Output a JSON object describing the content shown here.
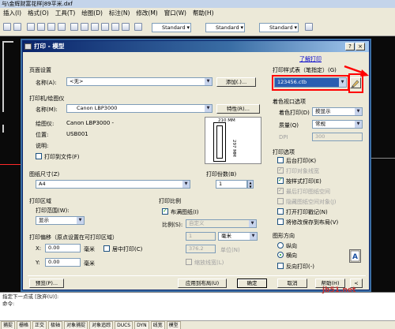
{
  "app": {
    "title": "与\\金辉财富花样|89平米.dxf"
  },
  "menu": [
    "插入(I)",
    "格式(O)",
    "工具(T)",
    "绘图(D)",
    "标注(N)",
    "修改(M)",
    "窗口(W)",
    "帮助(H)"
  ],
  "toolbar": {
    "style1": "Standard",
    "style2": "Standard",
    "style3": "Standard"
  },
  "command_line": [
    "指定下一点或 [放弃(U)]:",
    "命令:"
  ],
  "statusbar": [
    "捕捉",
    "栅格",
    "正交",
    "极轴",
    "对象捕捉",
    "对象追踪",
    "DUCS",
    "DYN",
    "线宽",
    "模型"
  ],
  "dialog": {
    "title": "打印 - 模型",
    "help_icon": "?",
    "close_icon": "×",
    "learn_link": "了解打印",
    "page_setup": {
      "group": "页面设置",
      "name_label": "名称(A):",
      "name_value": "<无>",
      "add_button": "添加(.)..."
    },
    "printer": {
      "group": "打印机/绘图仪",
      "name_label": "名称(M):",
      "name_value": "Canon LBP3000",
      "properties_button": "特性(R)...",
      "plotter_label": "绘图仪:",
      "plotter_value": "Canon LBP3000 -",
      "where_label": "位置:",
      "where_value": "USB001",
      "desc_label": "说明:",
      "print_to_file": "打印到文件(F)"
    },
    "preview": {
      "width_dim": "210 MM",
      "height_dim": "297 MM"
    },
    "paper_size": {
      "group": "图纸尺寸(Z)",
      "value": "A4"
    },
    "copies": {
      "label": "打印份数(B)",
      "value": "1"
    },
    "plot_area": {
      "group": "打印区域",
      "range_label": "打印范围(W):",
      "range_value": "显示"
    },
    "plot_scale": {
      "group": "打印比例",
      "fit_paper": "布满图纸(I)",
      "scale_label": "比例(S):",
      "scale_value": "自定义",
      "value1": "1",
      "unit1": "毫米",
      "value2": "376.2",
      "unit2": "单位(N)",
      "scale_lineweights": "缩放线宽(L)"
    },
    "plot_offset": {
      "group": "打印偏移（原点设置在可打印区域）",
      "x_label": "X:",
      "x_value": "0.00",
      "x_unit": "毫米",
      "center_plot": "居中打印(C)",
      "y_label": "Y:",
      "y_value": "0.00",
      "y_unit": "毫米"
    },
    "plot_style": {
      "group": "打印样式表（笔指定）(G)",
      "value": "123456.ctb"
    },
    "shaded": {
      "group": "着色视口选项",
      "shade_label": "着色打印(D)",
      "shade_value": "按显示",
      "quality_label": "质量(Q)",
      "quality_value": "常规",
      "dpi_label": "DPI",
      "dpi_value": "300"
    },
    "options": {
      "group": "打印选项",
      "items": [
        {
          "label": "后台打印(K)",
          "checked": false,
          "disabled": false
        },
        {
          "label": "打印对象线宽",
          "checked": true,
          "disabled": true
        },
        {
          "label": "按样式打印(E)",
          "checked": true,
          "disabled": false
        },
        {
          "label": "最后打印图纸空间",
          "checked": true,
          "disabled": true
        },
        {
          "label": "隐藏图纸空间对象(J)",
          "checked": false,
          "disabled": true
        },
        {
          "label": "打开打印戳记(N)",
          "checked": false,
          "disabled": false
        },
        {
          "label": "将修改保存到布局(V)",
          "checked": false,
          "disabled": false
        }
      ]
    },
    "orientation": {
      "group": "图形方向",
      "portrait": "纵向",
      "landscape": "横向",
      "upside_down": "反向打印(-)",
      "selected": "landscape"
    },
    "buttons": {
      "preview": "预览(P)...",
      "apply_layout": "应用到布局(U)",
      "ok": "确定",
      "cancel": "取消",
      "help": "帮助(H)",
      "expand": "<"
    }
  },
  "watermark": {
    "site": "jb51.net",
    "name": "脚本之家"
  },
  "colors": {
    "highlight_red": "#ff0000",
    "title_blue": "#0a246a",
    "selection_blue": "#2a5db0"
  }
}
